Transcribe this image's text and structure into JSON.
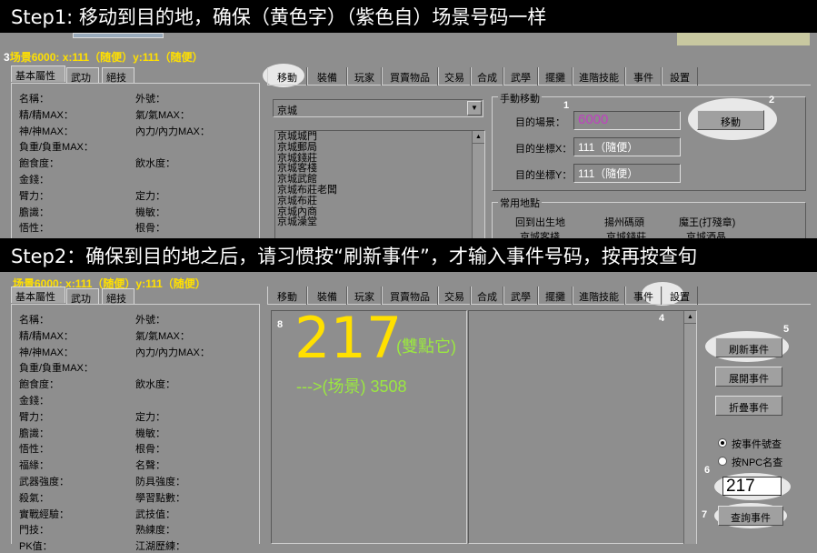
{
  "step1": {
    "banner": "Step1: 移动到目的地，确保（黄色字）（紫色自）场景号码一样",
    "status": "场景6000: x:111（随便）y:111（随便）",
    "badge": "3",
    "left_tabs": [
      "基本屬性",
      "武功",
      "絕技"
    ],
    "stats": [
      [
        "名稱：",
        "外號："
      ],
      [
        "精/精MAX：",
        "氣/氣MAX："
      ],
      [
        "神/神MAX：",
        "內力/內力MAX："
      ],
      [
        "負重/負重MAX：",
        ""
      ],
      [
        "飽食度：",
        "飲水度："
      ],
      [
        "金錢：",
        ""
      ],
      [
        "臂力：",
        "定力："
      ],
      [
        "膽識：",
        "機敏："
      ],
      [
        "悟性：",
        "根骨："
      ]
    ],
    "tabs": [
      "移動",
      "裝備",
      "玩家",
      "買賣物品",
      "交易",
      "合成",
      "武學",
      "擺攤",
      "進階技能",
      "事件",
      "設置"
    ],
    "dropdown_value": "京城",
    "list": [
      "京城城門",
      "京城郵局",
      "京城錢莊",
      "京城客棧",
      "京城武館",
      "京城布莊老闆",
      "京城布莊",
      "京城內商",
      "京城澡堂"
    ],
    "manual_group_title": "手動移動",
    "target_scene_label": "目的場景：",
    "target_scene_value": "6000",
    "target_x_label": "目的坐標X：",
    "target_x_value": "111（隨便）",
    "target_y_label": "目的坐標Y：",
    "target_y_value": "111（隨便）",
    "move_button": "移動",
    "common_group_title": "常用地點",
    "common_places": [
      "回到出生地",
      "揚州碼頭",
      "魔王(打殘章)"
    ],
    "common_places_row2": [
      "京城客棧",
      "京城錢莊",
      "京城酒晶"
    ],
    "marker1": "1",
    "marker2": "2"
  },
  "step2": {
    "banner": "Step2：确保到目的地之后，请习惯按“刷新事件”，才输入事件号码，按再按查旬",
    "status": "场景6000: x:111（随便）y:111（随便）",
    "left_tabs": [
      "基本屬性",
      "武功",
      "絕技"
    ],
    "stats": [
      [
        "名稱：",
        "外號："
      ],
      [
        "精/精MAX：",
        "氣/氣MAX："
      ],
      [
        "神/神MAX：",
        "內力/內力MAX："
      ],
      [
        "負重/負重MAX：",
        ""
      ],
      [
        "飽食度：",
        "飲水度："
      ],
      [
        "金錢：",
        ""
      ],
      [
        "臂力：",
        "定力："
      ],
      [
        "膽識：",
        "機敏："
      ],
      [
        "悟性：",
        "根骨："
      ],
      [
        "福緣：",
        "名聲："
      ],
      [
        "武器強度：",
        "防具強度："
      ],
      [
        "殺氣：",
        "學習點數："
      ],
      [
        "實戰經驗：",
        "武技值："
      ],
      [
        "門技：",
        "熟練度："
      ],
      [
        "PK值：",
        "江湖歷練："
      ]
    ],
    "tabs": [
      "移動",
      "裝備",
      "玩家",
      "買賣物品",
      "交易",
      "合成",
      "武學",
      "擺攤",
      "進階技能",
      "事件",
      "設置"
    ],
    "event_big_number": "217",
    "event_note": "(雙點它)",
    "event_arrow": "--->(场景) 3508",
    "refresh_button": "刷新事件",
    "expand_button": "展開事件",
    "collapse_button": "折疊事件",
    "radio1": "按事件號查",
    "radio2": "按NPC名查",
    "query_input": "217",
    "query_button": "查詢事件",
    "markers": {
      "m4": "4",
      "m5": "5",
      "m6": "6",
      "m7": "7",
      "m8": "8"
    }
  },
  "colors": {
    "yellow": "#ffe000",
    "purple": "#c040c0",
    "green": "#9be840",
    "gray": "#8e8e8e"
  }
}
